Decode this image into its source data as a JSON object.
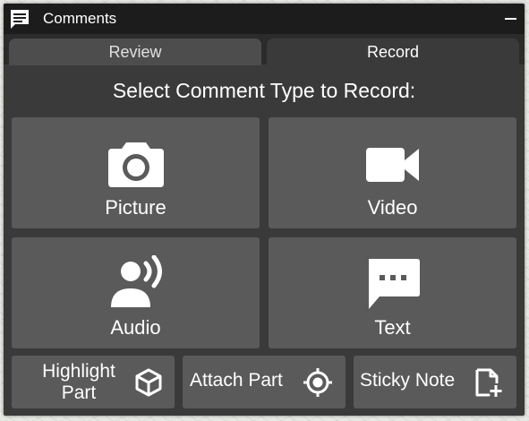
{
  "window": {
    "title": "Comments",
    "title_icon": "comment-icon",
    "minimize_icon": "minimize-icon"
  },
  "tabs": [
    {
      "label": "Review",
      "active": false
    },
    {
      "label": "Record",
      "active": true
    }
  ],
  "heading": "Select Comment Type to Record:",
  "tiles": [
    {
      "label": "Picture",
      "icon": "camera-icon"
    },
    {
      "label": "Video",
      "icon": "video-camera-icon"
    },
    {
      "label": "Audio",
      "icon": "speaking-person-icon"
    },
    {
      "label": "Text",
      "icon": "text-bubble-icon"
    }
  ],
  "actions": [
    {
      "label_line1": "Highlight",
      "label_line2": "Part",
      "icon": "cube-icon"
    },
    {
      "label": "Attach Part",
      "icon": "target-icon"
    },
    {
      "label": "Sticky Note",
      "icon": "add-note-icon"
    }
  ],
  "colors": {
    "title_bar": "#1c1c1c",
    "panel": "#3a3a3a",
    "tile": "#5a5a5a",
    "inactive_tab": "#4d4d4d",
    "text": "#ffffff"
  }
}
